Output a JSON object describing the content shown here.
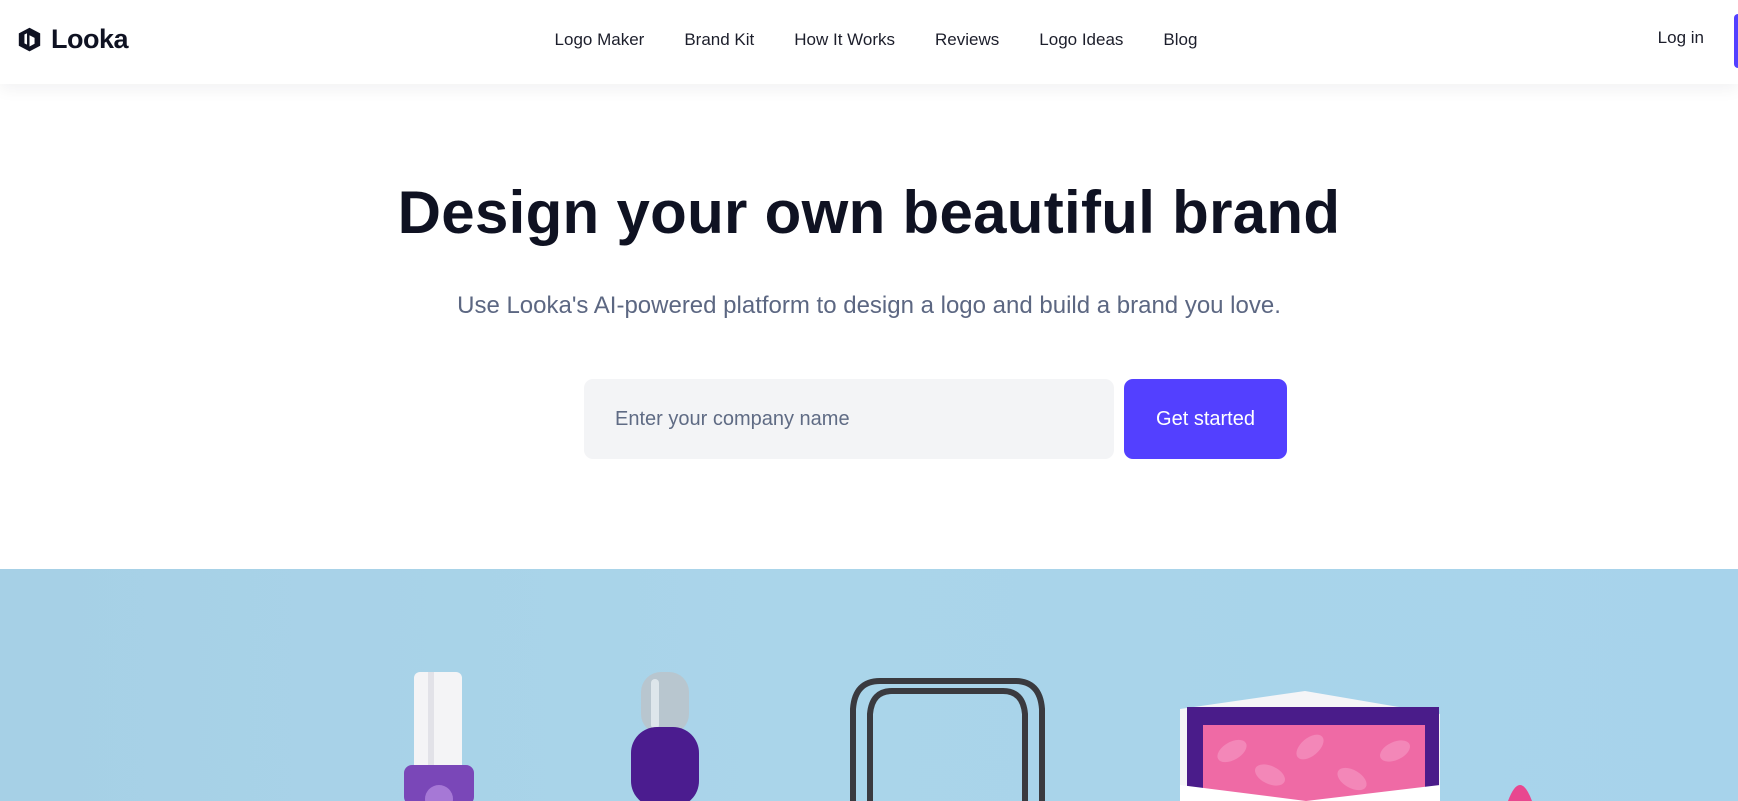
{
  "brand": {
    "name": "Looka",
    "logo_icon": "looka-hexagon-icon",
    "accent_color": "#5340ff"
  },
  "nav": {
    "links": [
      "Logo Maker",
      "Brand Kit",
      "How It Works",
      "Reviews",
      "Logo Ideas",
      "Blog"
    ],
    "login_label": "Log in"
  },
  "hero": {
    "title": "Design your own beautiful brand",
    "subtitle": "Use Looka's AI-powered platform to design a logo and build a brand you love.",
    "input_placeholder": "Enter your company name",
    "input_value": "",
    "cta_label": "Get started"
  },
  "showcase": {
    "background_color": "#a8d3e9",
    "items": [
      "nail-polish-bottle",
      "spray-can",
      "shopping-bag",
      "envelope-card",
      "pink-object"
    ]
  }
}
